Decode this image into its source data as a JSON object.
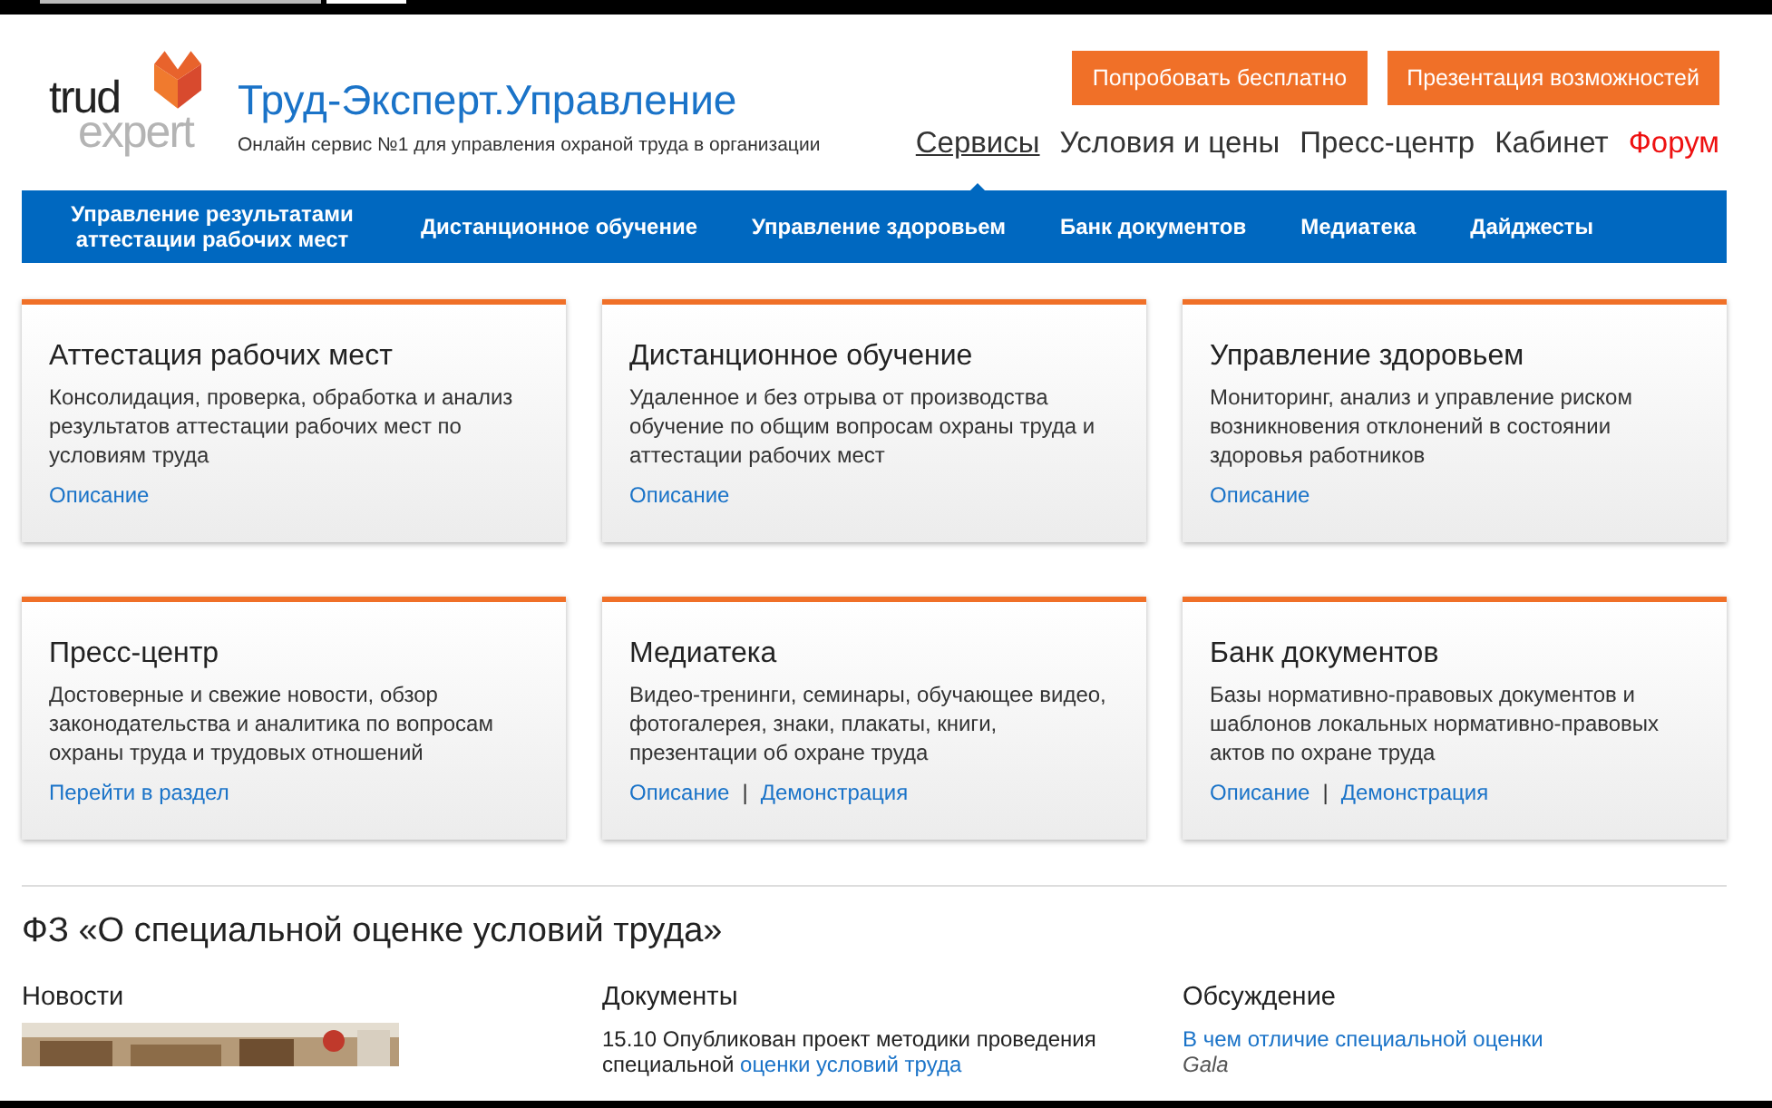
{
  "header": {
    "logo": {
      "word1": "trud",
      "word2": "expert"
    },
    "title": "Труд-Эксперт.Управление",
    "subtitle": "Онлайн сервис №1 для управления охраной труда в организации",
    "buttons": [
      "Попробовать бесплатно",
      "Презентация возможностей"
    ],
    "menu": [
      {
        "label": "Сервисы",
        "selected": true,
        "kind": "normal"
      },
      {
        "label": "Условия и цены",
        "selected": false,
        "kind": "normal"
      },
      {
        "label": "Пресс-центр",
        "selected": false,
        "kind": "normal"
      },
      {
        "label": "Кабинет",
        "selected": false,
        "kind": "normal"
      },
      {
        "label": "Форум",
        "selected": false,
        "kind": "highlight"
      }
    ]
  },
  "nav": {
    "items": [
      "Управление результатами аттестации рабочих мест",
      "Дистанционное обучение",
      "Управление здоровьем",
      "Банк документов",
      "Медиатека",
      "Дайджесты"
    ]
  },
  "cards": [
    {
      "title": "Аттестация рабочих мест",
      "description": "Консолидация, проверка, обработка и анализ результатов аттестации рабочих мест по условиям труда",
      "links": [
        "Описание"
      ]
    },
    {
      "title": "Дистанционное обучение",
      "description": "Удаленное и без отрыва от производства обучение по общим вопросам охраны труда и аттестации рабочих мест",
      "links": [
        "Описание"
      ]
    },
    {
      "title": "Управление здоровьем",
      "description": "Мониторинг, анализ и управление риском возникновения отклонений в состоянии здоровья работников",
      "links": [
        "Описание"
      ]
    },
    {
      "title": "Пресс-центр",
      "description": "Достоверные и свежие новости, обзор законодательства и аналитика по вопросам охраны труда и трудовых отношений",
      "links": [
        "Перейти в раздел"
      ]
    },
    {
      "title": "Медиатека",
      "description": "Видео-тренинги, семинары, обучающее видео, фотогалерея, знаки, плакаты, книги, презентации об охране труда",
      "links": [
        "Описание",
        "Демонстрация"
      ]
    },
    {
      "title": "Банк документов",
      "description": "Базы нормативно-правовых документов и шаблонов локальных нормативно-правовых актов по охране труда",
      "links": [
        "Описание",
        "Демонстрация"
      ]
    }
  ],
  "link_separator": "|",
  "section": {
    "title": "ФЗ «О специальной оценке условий труда»",
    "columns": [
      {
        "heading": "Новости",
        "kind": "news"
      },
      {
        "heading": "Документы",
        "kind": "documents",
        "date": "15.10",
        "text": "Опубликован проект методики проведения специальной",
        "link": "оценки условий труда"
      },
      {
        "heading": "Обсуждение",
        "kind": "discussion",
        "link": "В чем отличие специальной оценки",
        "author": "Gala"
      }
    ]
  }
}
